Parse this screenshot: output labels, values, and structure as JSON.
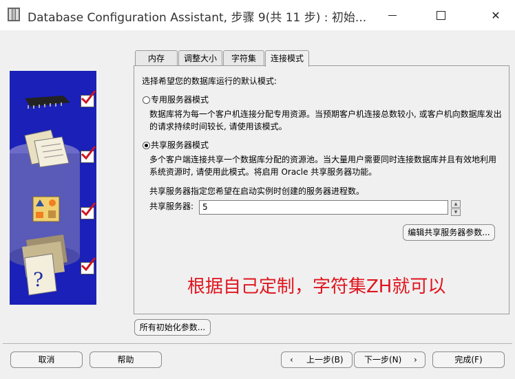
{
  "window": {
    "title": "Database Configuration Assistant, 步骤 9(共 11 步) : 初始..."
  },
  "tabs": [
    {
      "label": "内存"
    },
    {
      "label": "调整大小"
    },
    {
      "label": "字符集"
    },
    {
      "label": "连接模式"
    }
  ],
  "panel": {
    "prompt": "选择希望您的数据库运行的默认模式:",
    "dedicated": {
      "label": "专用服务器模式",
      "desc_line1": "数据库将为每一个客户机连接分配专用资源。当预期客户机连接总数较小, 或客户机向数据库发出",
      "desc_line2": "的请求持续时间较长, 请使用该模式。",
      "selected": false
    },
    "shared": {
      "label": "共享服务器模式",
      "desc_line1": "多个客户端连接共享一个数据库分配的资源池。当大量用户需要同时连接数据库并且有效地利用",
      "desc_line2": "系统资源时, 请使用此模式。将启用 Oracle 共享服务器功能。",
      "selected": true
    },
    "servers_note": "共享服务器指定您希望在启动实例时创建的服务器进程数。",
    "servers_label": "共享服务器:",
    "servers_value": "5",
    "edit_params_button": "编辑共享服务器参数..."
  },
  "annotation": "根据自己定制，字符集ZH就可以",
  "all_params_button": "所有初始化参数...",
  "footer": {
    "cancel": "取消",
    "help": "帮助",
    "back": "上一步(B)",
    "next": "下一步(N)",
    "finish": "完成(F)"
  },
  "colors": {
    "graphic_bg": "#1a20b8",
    "annotation": "#e0141e",
    "check": "#d0141e"
  }
}
